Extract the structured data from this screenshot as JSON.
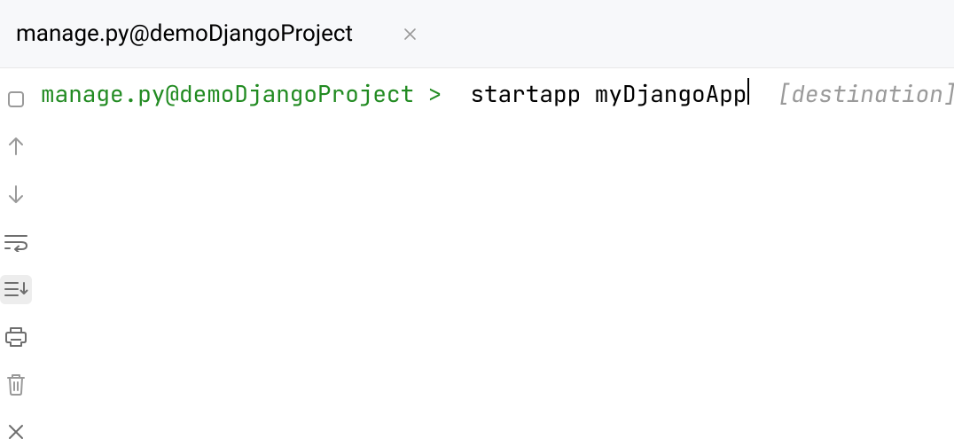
{
  "tab": {
    "label": "manage.py@demoDjangoProject"
  },
  "prompt": {
    "label": "manage.py@demoDjangoProject >"
  },
  "command": {
    "value": "startapp myDjangoApp"
  },
  "hint": {
    "text": "[destination]"
  },
  "toolbar": {
    "stop": "stop-icon",
    "up": "arrow-up-icon",
    "down": "arrow-down-icon",
    "wrap": "soft-wrap-icon",
    "scrollend": "scroll-to-end-icon",
    "print": "print-icon",
    "delete": "trash-icon",
    "close": "close-panel-icon"
  }
}
